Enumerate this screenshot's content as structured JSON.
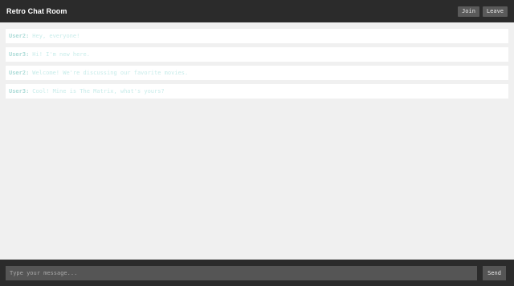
{
  "header": {
    "title": "Retro Chat Room",
    "join_label": "Join",
    "leave_label": "Leave"
  },
  "messages": [
    {
      "user": "User2:",
      "text": "Hey, everyone!"
    },
    {
      "user": "User3:",
      "text": "Hi! I'm new here."
    },
    {
      "user": "User2:",
      "text": "Welcome! We're discussing our favorite movies."
    },
    {
      "user": "User3:",
      "text": "Cool! Mine is The Matrix, what's yours?"
    }
  ],
  "composer": {
    "placeholder": "Type your message...",
    "send_label": "Send"
  },
  "colors": {
    "header_bg": "#2b2b2b",
    "page_bg": "#f0f0f0",
    "username": "#aedcd8",
    "message_text": "#c8ecea",
    "button_bg": "#5a5a5a"
  }
}
